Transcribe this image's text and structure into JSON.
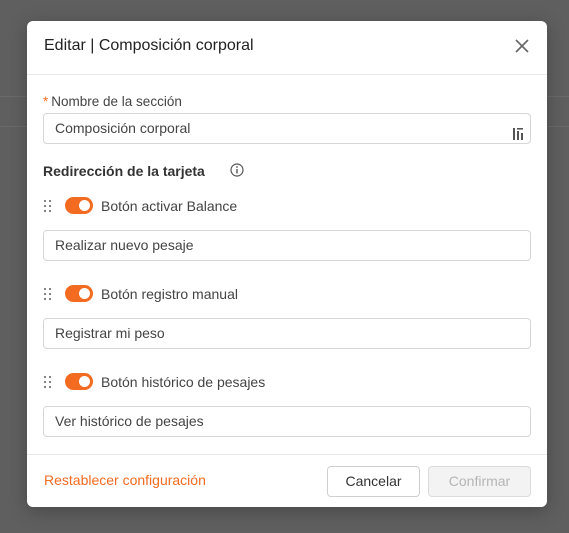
{
  "dialog": {
    "title": "Editar | Composición corporal"
  },
  "section_name": {
    "required_mark": "*",
    "label": "Nombre de la sección",
    "value": "Composición corporal"
  },
  "redirect": {
    "title": "Redirección de la tarjeta",
    "items": [
      {
        "toggle_label": "Botón activar Balance",
        "enabled": true,
        "input_value": "Realizar nuevo pesaje"
      },
      {
        "toggle_label": "Botón registro manual",
        "enabled": true,
        "input_value": "Registrar mi peso"
      },
      {
        "toggle_label": "Botón histórico de pesajes",
        "enabled": true,
        "input_value": "Ver histórico de pesajes"
      }
    ]
  },
  "footer": {
    "reset_label": "Restablecer configuración",
    "cancel_label": "Cancelar",
    "confirm_label": "Confirmar"
  },
  "colors": {
    "accent": "#f26b21",
    "overlay": "#5f5f5f",
    "disabled_text": "#b5b5b5"
  }
}
